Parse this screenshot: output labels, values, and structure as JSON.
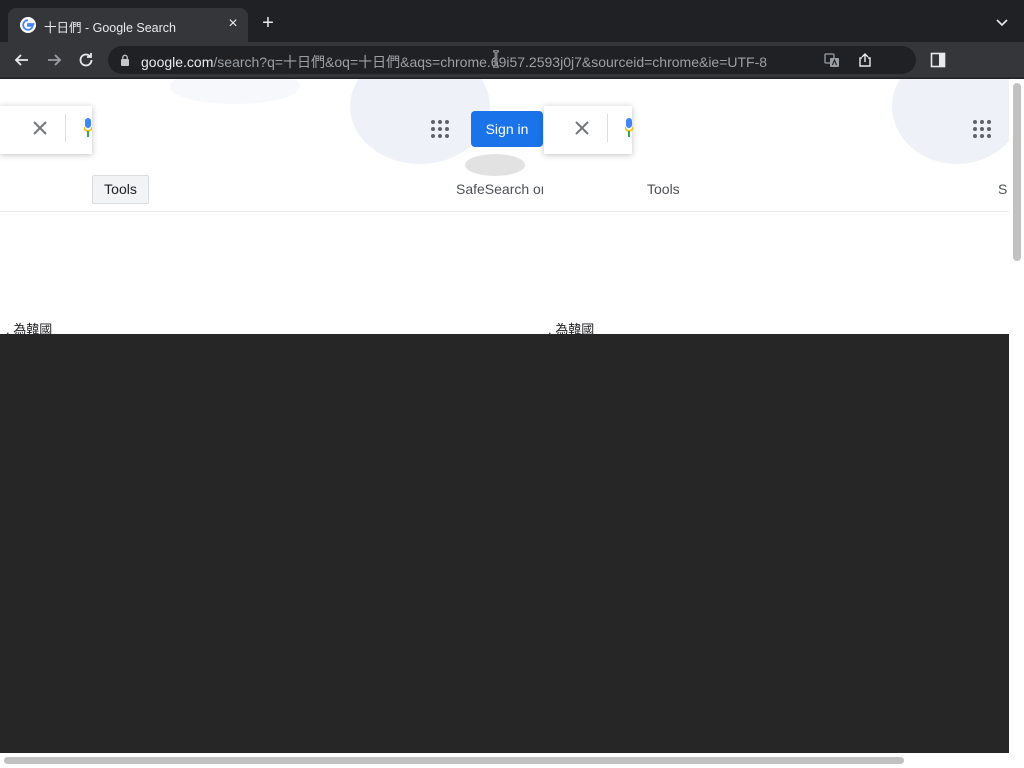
{
  "browser": {
    "tab": {
      "title": "十日們 - Google Search",
      "close": "×"
    },
    "new_tab": "+",
    "url_host": "google.com",
    "url_rest": "/search?q=十日們&oq=十日們&aqs=chrome.69i57.2593j0j7&sourceid=chrome&ie=UTF-8"
  },
  "page": {
    "sign_in": "Sign in",
    "tools_left": "Tools",
    "tools_right": "Tools",
    "safesearch": "SafeSearch on",
    "safesearch_right": "S",
    "snippet_left": ", 為韓國",
    "snippet_right": ", 為韓國"
  },
  "colors": {
    "sign_in_bg": "#1a73e8",
    "chrome_bg": "#202124",
    "toolbar_bg": "#35363a"
  },
  "icons": [
    "google-favicon",
    "close-icon",
    "plus-icon",
    "chevron-down-icon",
    "back-arrow-icon",
    "forward-arrow-icon",
    "reload-icon",
    "lock-icon",
    "translate-icon",
    "share-icon",
    "side-panel-icon",
    "apps-grid-icon",
    "mic-icon",
    "text-cursor-icon"
  ]
}
